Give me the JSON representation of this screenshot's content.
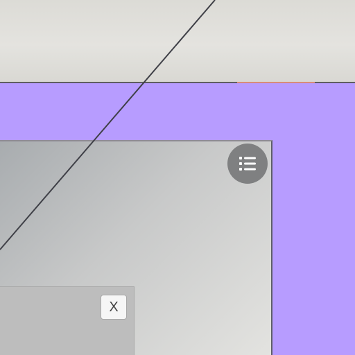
{
  "dialog": {
    "close_label": "X"
  },
  "icons": {
    "list": "list-icon"
  },
  "colors": {
    "background_accent": "#b79cff",
    "top_panel": "#e0dfdb",
    "card": "#c8c9c9",
    "dialog": "#bdbdbd",
    "line": "#3f4047"
  }
}
